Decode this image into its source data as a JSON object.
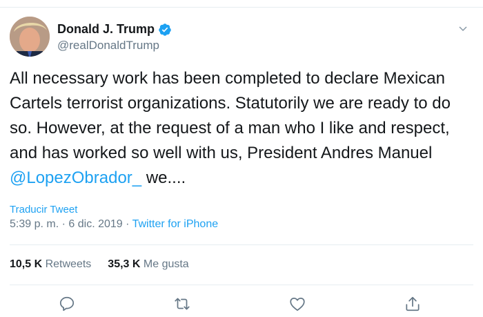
{
  "author": {
    "display_name": "Donald J. Trump",
    "handle": "@realDonaldTrump",
    "verified": true
  },
  "tweet": {
    "text_before_mention": "All necessary work has been completed to declare Mexican Cartels terrorist organizations. Statutorily we are ready to do so. However, at the request of a man who I like and respect, and has worked so well with us, President Andres Manuel ",
    "mention": "@LopezObrador_",
    "text_after_mention": " we...."
  },
  "translate_label": "Traducir Tweet",
  "meta": {
    "time": "5:39 p. m.",
    "separator": "·",
    "date": "6 dic. 2019",
    "source": "Twitter for iPhone"
  },
  "stats": {
    "retweets_count": "10,5 K",
    "retweets_label": "Retweets",
    "likes_count": "35,3 K",
    "likes_label": "Me gusta"
  },
  "icons": {
    "reply": "reply-icon",
    "retweet": "retweet-icon",
    "like": "heart-icon",
    "share": "share-icon",
    "menu": "chevron-down-icon",
    "verified": "verified-badge-icon"
  },
  "colors": {
    "link": "#1da1f2",
    "secondary_text": "#657786",
    "primary_text": "#14171a"
  }
}
